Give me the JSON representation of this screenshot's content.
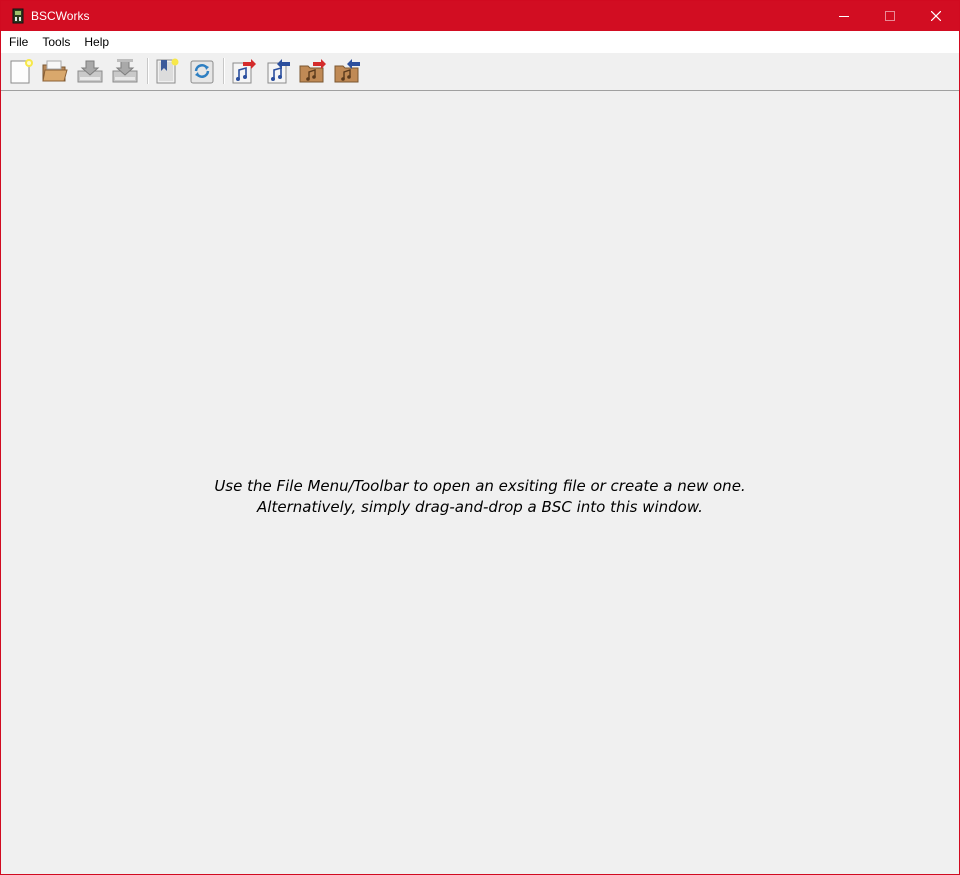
{
  "window": {
    "title": "BSCWorks"
  },
  "menu": {
    "file": "File",
    "tools": "Tools",
    "help": "Help"
  },
  "toolbar": {
    "buttons": [
      {
        "icon": "new-file-icon"
      },
      {
        "icon": "open-folder-icon"
      },
      {
        "icon": "save-icon"
      },
      {
        "icon": "save-as-icon"
      },
      {
        "icon": "new-bookmark-icon"
      },
      {
        "icon": "refresh-icon"
      },
      {
        "icon": "export-music-icon"
      },
      {
        "icon": "import-music-icon"
      },
      {
        "icon": "export-music-folder-icon"
      },
      {
        "icon": "import-music-folder-icon"
      }
    ]
  },
  "main": {
    "message_line1": "Use the File Menu/Toolbar to open an exsiting file or create a new one.",
    "message_line2": "Alternatively, simply drag-and-drop a BSC into this window."
  },
  "colors": {
    "titlebar": "#d20d22",
    "background": "#f0f0f0"
  }
}
